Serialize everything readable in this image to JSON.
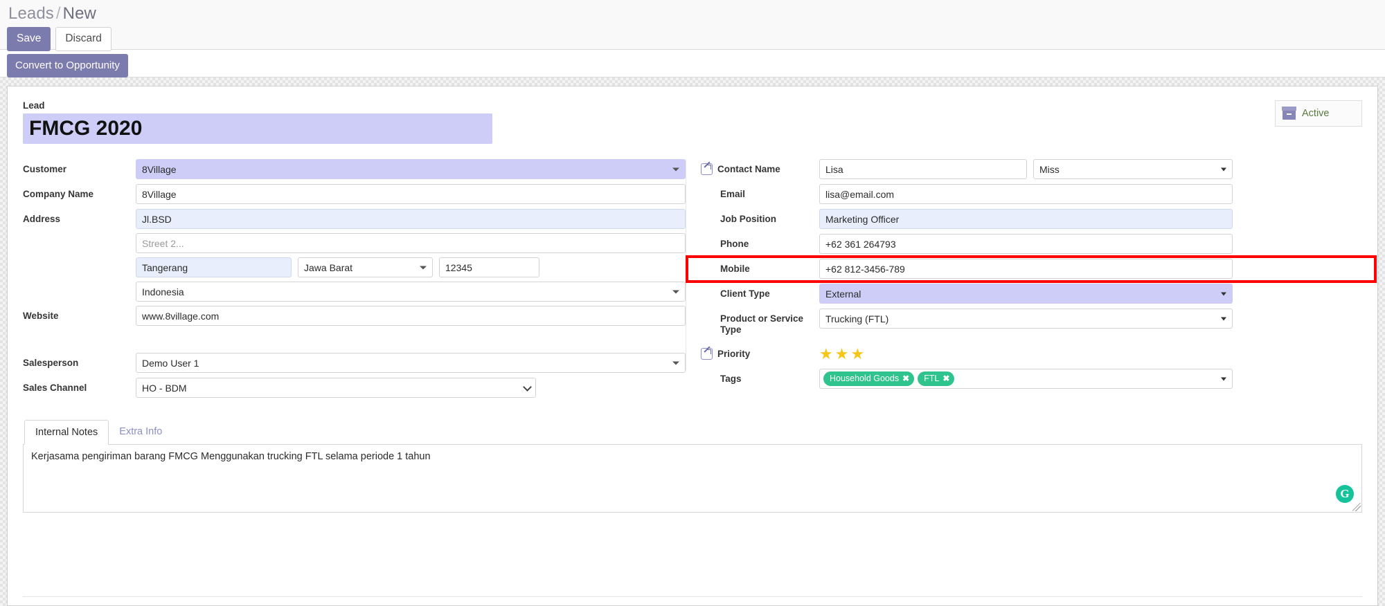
{
  "breadcrumb": {
    "root": "Leads",
    "separator": "/",
    "current": "New"
  },
  "toolbar": {
    "save_label": "Save",
    "discard_label": "Discard"
  },
  "action_bar": {
    "convert_label": "Convert to Opportunity"
  },
  "status": {
    "label": "Active",
    "icon": "archive-box-icon"
  },
  "lead": {
    "section_label": "Lead",
    "title": "FMCG 2020"
  },
  "left": {
    "customer": {
      "label": "Customer",
      "value": "8Village"
    },
    "company_name": {
      "label": "Company Name",
      "value": "8Village"
    },
    "address": {
      "label": "Address",
      "street": "Jl.BSD",
      "street2_placeholder": "Street 2...",
      "city": "Tangerang",
      "state": "Jawa Barat",
      "zip": "12345",
      "country": "Indonesia"
    },
    "website": {
      "label": "Website",
      "value": "www.8village.com"
    },
    "salesperson": {
      "label": "Salesperson",
      "value": "Demo User 1"
    },
    "sales_channel": {
      "label": "Sales Channel",
      "value": "HO - BDM"
    }
  },
  "right": {
    "contact_name": {
      "label": "Contact Name",
      "value": "Lisa",
      "title": "Miss"
    },
    "email": {
      "label": "Email",
      "value": "lisa@email.com"
    },
    "job_position": {
      "label": "Job Position",
      "value": "Marketing Officer"
    },
    "phone": {
      "label": "Phone",
      "value": "+62 361 264793"
    },
    "mobile": {
      "label": "Mobile",
      "value": "+62 812-3456-789"
    },
    "client_type": {
      "label": "Client Type",
      "value": "External"
    },
    "product_service_type": {
      "label": "Product or Service Type",
      "value": "Trucking (FTL)"
    },
    "priority": {
      "label": "Priority",
      "stars_filled": 3,
      "star_glyph": "★"
    },
    "tags": {
      "label": "Tags",
      "items": [
        {
          "name": "Household Goods",
          "remove": "✖"
        },
        {
          "name": "FTL",
          "remove": "✖"
        }
      ]
    }
  },
  "tabs": [
    {
      "label": "Internal Notes",
      "active": true
    },
    {
      "label": "Extra Info",
      "active": false
    }
  ],
  "notes": {
    "value": "Kerjasama pengiriman barang FMCG Menggunakan trucking FTL selama periode 1 tahun"
  },
  "grammarly": {
    "glyph": "G"
  },
  "colors": {
    "accent_purple": "#7c7bad",
    "lavender_highlight": "#cdcdf7",
    "blue_tint": "#e8eefb",
    "tag_green": "#2fc48d",
    "star_gold": "#f5c518",
    "annotation_red": "#ff0000"
  }
}
